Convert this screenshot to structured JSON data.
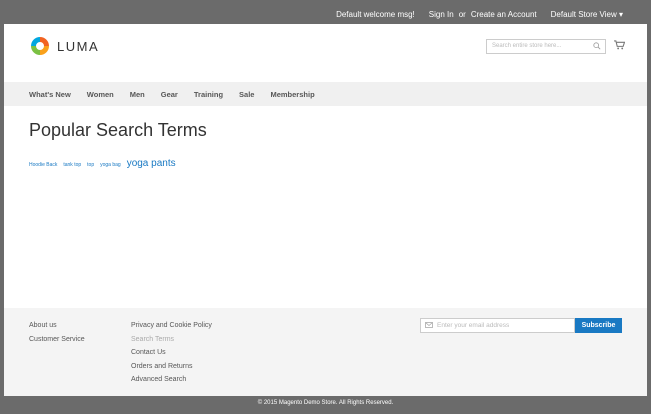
{
  "topbar": {
    "welcome": "Default welcome msg!",
    "sign_in": "Sign In",
    "or": "or",
    "create_account": "Create an Account",
    "store_view": "Default Store View"
  },
  "header": {
    "logo_text": "LUMA",
    "search_placeholder": "Search entire store here..."
  },
  "nav": {
    "items": [
      "What's New",
      "Women",
      "Men",
      "Gear",
      "Training",
      "Sale",
      "Membership"
    ]
  },
  "main": {
    "title": "Popular Search Terms",
    "terms": [
      {
        "label": "Hoodie Back",
        "size": "sm"
      },
      {
        "label": "tank top",
        "size": "sm"
      },
      {
        "label": "top",
        "size": "sm"
      },
      {
        "label": "yoga bag",
        "size": "sm"
      },
      {
        "label": "yoga pants",
        "size": "lg"
      }
    ]
  },
  "footer": {
    "col1": [
      "About us",
      "Customer Service"
    ],
    "col2": [
      "Privacy and Cookie Policy",
      "Search Terms",
      "Contact Us",
      "Orders and Returns",
      "Advanced Search"
    ],
    "newsletter_placeholder": "Enter your email address",
    "subscribe": "Subscribe",
    "copyright": "© 2015 Magento Demo Store. All Rights Reserved."
  },
  "colors": {
    "accent": "#1979c3",
    "topbar": "#6b6b6b"
  }
}
